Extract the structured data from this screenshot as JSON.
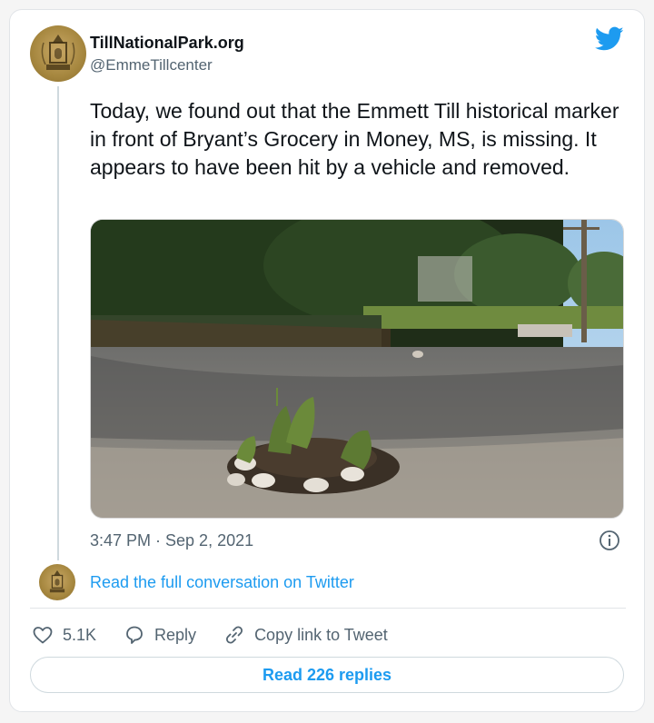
{
  "account": {
    "name": "TillNationalPark.org",
    "handle": "@EmmeTillcenter"
  },
  "tweet": {
    "text": "Today, we found out that the Emmett Till historical marker in front of Bryant’s Grocery in Money, MS, is missing. It appears to have been hit by a vehicle and removed.",
    "timestamp": "3:47 PM · Sep 2, 2021"
  },
  "conversation": {
    "link_label": "Read the full conversation on Twitter"
  },
  "actions": {
    "like_count": "5.1K",
    "reply_label": "Reply",
    "copy_link_label": "Copy link to Tweet"
  },
  "replies_button": {
    "label": "Read 226 replies"
  },
  "icons": {
    "brand": "twitter-bird-icon",
    "info": "info-icon",
    "like": "heart-icon",
    "reply": "speech-bubble-icon",
    "copy_link": "link-icon"
  },
  "colors": {
    "accent": "#1d9bf0",
    "secondary_text": "#536471",
    "avatar_gold": "#a6873f"
  }
}
